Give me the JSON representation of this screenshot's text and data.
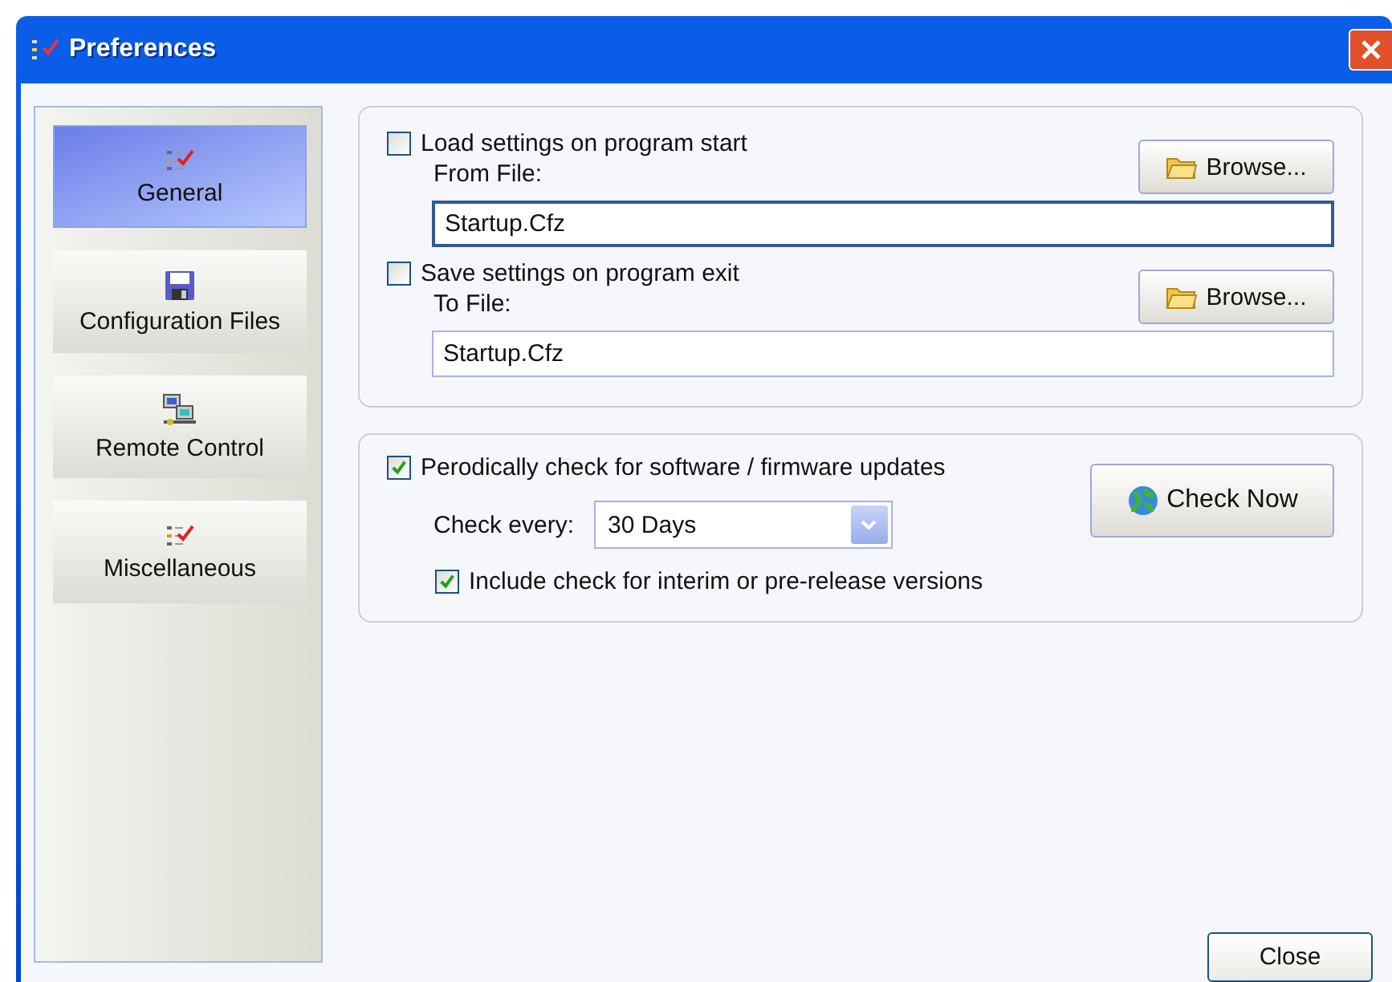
{
  "window": {
    "title": "Preferences"
  },
  "sidebar": {
    "items": [
      {
        "label": "General",
        "kind": "checklist",
        "selected": true
      },
      {
        "label": "Configuration Files",
        "kind": "floppy",
        "selected": false
      },
      {
        "label": "Remote Control",
        "kind": "network",
        "selected": false
      },
      {
        "label": "Miscellaneous",
        "kind": "checklist",
        "selected": false
      }
    ]
  },
  "file_settings": [
    {
      "label": "Load settings on program start",
      "checked": false,
      "field_label": "From File:",
      "value": "Startup.Cfz",
      "button": "Browse...",
      "focused": true
    },
    {
      "label": "Save settings on program exit",
      "checked": false,
      "field_label": "To File:",
      "value": "Startup.Cfz",
      "button": "Browse...",
      "focused": false
    }
  ],
  "updates": {
    "label": "Perodically check for software / firmware updates",
    "checked": true,
    "interval_label": "Check every:",
    "interval_value": "30 Days",
    "button": "Check Now",
    "prerelease_label": "Include check for interim or pre-release versions",
    "prerelease_checked": true
  },
  "buttons": [
    "Close"
  ]
}
